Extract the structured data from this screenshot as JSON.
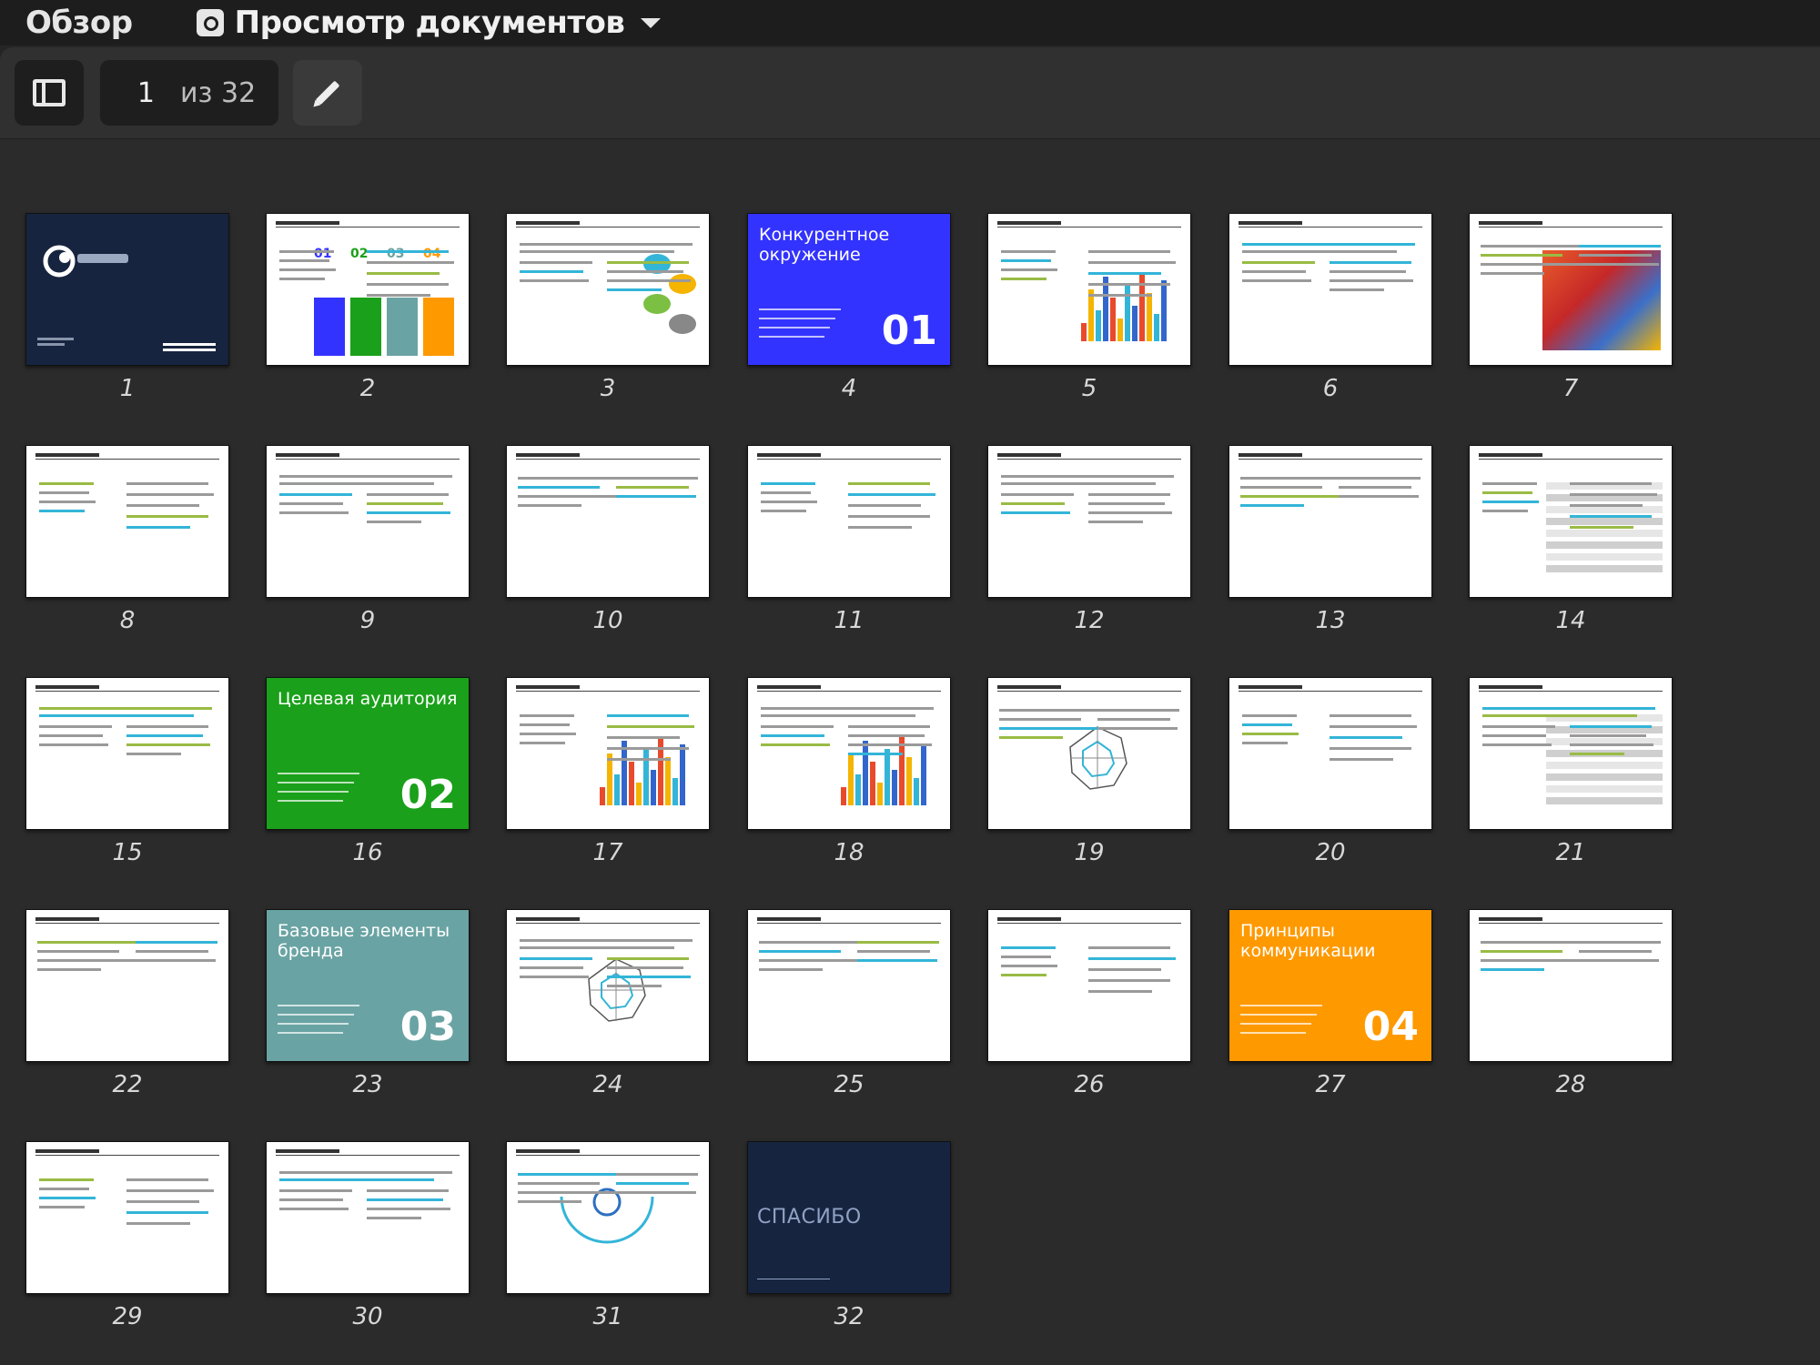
{
  "topbar": {
    "overview_label": "Обзор",
    "app_name": "Просмотр документов"
  },
  "toolbar": {
    "current_page": "1",
    "page_of": "из 32"
  },
  "colors": {
    "accent_blue": "#3333ff",
    "accent_green": "#1aa01a",
    "accent_teal": "#6aa3a3",
    "accent_orange": "#ff9900",
    "navy": "#17243f"
  },
  "pages": [
    {
      "n": "1",
      "label": "1",
      "kind": "cover"
    },
    {
      "n": "2",
      "label": "2",
      "kind": "contents",
      "items": [
        "01",
        "02",
        "03",
        "04"
      ]
    },
    {
      "n": "3",
      "label": "3",
      "kind": "text-bubbles"
    },
    {
      "n": "4",
      "label": "4",
      "kind": "section",
      "title": "Конкурентное окружение",
      "num": "01",
      "bg": "#3333ff"
    },
    {
      "n": "5",
      "label": "5",
      "kind": "chart"
    },
    {
      "n": "6",
      "label": "6",
      "kind": "text"
    },
    {
      "n": "7",
      "label": "7",
      "kind": "image"
    },
    {
      "n": "8",
      "label": "8",
      "kind": "text"
    },
    {
      "n": "9",
      "label": "9",
      "kind": "text"
    },
    {
      "n": "10",
      "label": "10",
      "kind": "text"
    },
    {
      "n": "11",
      "label": "11",
      "kind": "text"
    },
    {
      "n": "12",
      "label": "12",
      "kind": "text"
    },
    {
      "n": "13",
      "label": "13",
      "kind": "text"
    },
    {
      "n": "14",
      "label": "14",
      "kind": "table"
    },
    {
      "n": "15",
      "label": "15",
      "kind": "text"
    },
    {
      "n": "16",
      "label": "16",
      "kind": "section",
      "title": "Целевая аудитория",
      "num": "02",
      "bg": "#1aa01a"
    },
    {
      "n": "17",
      "label": "17",
      "kind": "chart"
    },
    {
      "n": "18",
      "label": "18",
      "kind": "chart"
    },
    {
      "n": "19",
      "label": "19",
      "kind": "radar"
    },
    {
      "n": "20",
      "label": "20",
      "kind": "text"
    },
    {
      "n": "21",
      "label": "21",
      "kind": "table"
    },
    {
      "n": "22",
      "label": "22",
      "kind": "text"
    },
    {
      "n": "23",
      "label": "23",
      "kind": "section",
      "title": "Базовые элементы бренда",
      "num": "03",
      "bg": "#6aa3a3"
    },
    {
      "n": "24",
      "label": "24",
      "kind": "radar"
    },
    {
      "n": "25",
      "label": "25",
      "kind": "text"
    },
    {
      "n": "26",
      "label": "26",
      "kind": "text"
    },
    {
      "n": "27",
      "label": "27",
      "kind": "section",
      "title": "Принципы коммуникации",
      "num": "04",
      "bg": "#ff9900"
    },
    {
      "n": "28",
      "label": "28",
      "kind": "text"
    },
    {
      "n": "29",
      "label": "29",
      "kind": "text"
    },
    {
      "n": "30",
      "label": "30",
      "kind": "text"
    },
    {
      "n": "31",
      "label": "31",
      "kind": "arc"
    },
    {
      "n": "32",
      "label": "32",
      "kind": "thanks",
      "title": "СПАСИБО"
    }
  ]
}
